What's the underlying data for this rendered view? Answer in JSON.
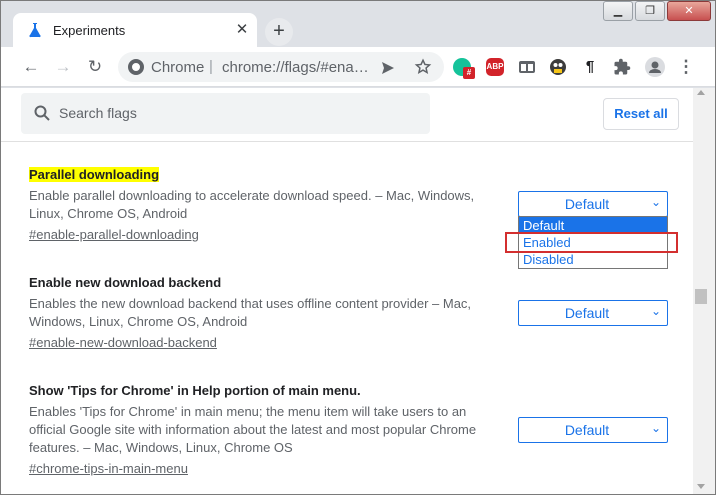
{
  "window": {
    "controls": [
      "minimize",
      "restore",
      "close"
    ]
  },
  "tab": {
    "title": "Experiments",
    "close_glyph": "✕",
    "icon": "flask-icon"
  },
  "newtab": {
    "glyph": "+"
  },
  "toolbar": {
    "back_glyph": "←",
    "forward_glyph": "→",
    "reload_glyph": "↻",
    "site": "Chrome",
    "separator": "|",
    "url": "chrome://flags/#ena…",
    "extensions": [
      {
        "name": "grammarly-extension-icon",
        "label": "#",
        "color": "#15c39a"
      },
      {
        "name": "adblock-plus-icon",
        "label": "ABP",
        "color": "#d2232a"
      },
      {
        "name": "tab-manager-icon",
        "label": "",
        "color": "#5f6368"
      },
      {
        "name": "tampermonkey-icon",
        "label": "",
        "color": "#3c3c3c"
      },
      {
        "name": "paragraph-icon",
        "label": "¶",
        "color": "#202124"
      },
      {
        "name": "extensions-puzzle-icon",
        "label": "",
        "color": "#5f6368"
      },
      {
        "name": "profile-avatar-icon",
        "label": "",
        "color": "#5f6368"
      },
      {
        "name": "menu-kebab-icon",
        "label": "⋮",
        "color": "#5f6368"
      }
    ]
  },
  "search": {
    "placeholder": "Search flags",
    "value": ""
  },
  "reset_all_label": "Reset all",
  "flags": [
    {
      "title": "Parallel downloading",
      "highlighted": true,
      "description": "Enable parallel downloading to accelerate download speed. – Mac, Windows, Linux, Chrome OS, Android",
      "link": "#enable-parallel-downloading",
      "select_value": "Default"
    },
    {
      "title": "Enable new download backend",
      "highlighted": false,
      "description": "Enables the new download backend that uses offline content provider – Mac, Windows, Linux, Chrome OS, Android",
      "link": "#enable-new-download-backend",
      "select_value": "Default"
    },
    {
      "title": "Show 'Tips for Chrome' in Help portion of main menu.",
      "highlighted": false,
      "description": "Enables 'Tips for Chrome' in main menu; the menu item will take users to an official Google site with information about the latest and most popular Chrome features. – Mac, Windows, Linux, Chrome OS",
      "link": "#chrome-tips-in-main-menu",
      "select_value": "Default"
    }
  ],
  "dropdown": {
    "options": [
      "Default",
      "Enabled",
      "Disabled"
    ],
    "selected_index": 0,
    "highlighted_option": "Enabled"
  },
  "colors": {
    "accent": "#1a73e8",
    "highlight": "#ffff00",
    "annotation_box": "#d32f2f"
  }
}
